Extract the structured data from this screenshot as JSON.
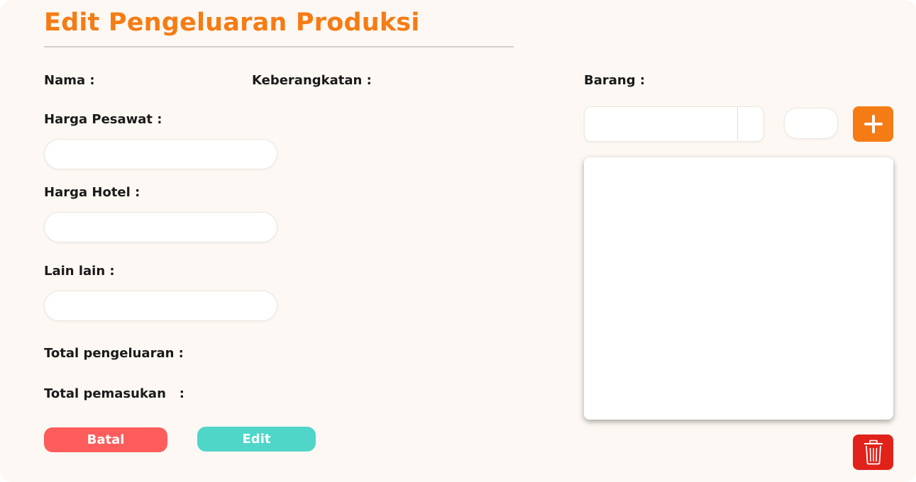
{
  "page": {
    "title": "Edit Pengeluaran Produksi"
  },
  "form": {
    "nama_label": "Nama :",
    "keberangkatan_label": "Keberangkatan :",
    "harga_pesawat_label": "Harga Pesawat :",
    "harga_pesawat_value": "",
    "harga_hotel_label": "Harga Hotel :",
    "harga_hotel_value": "",
    "lain_lain_label": "Lain lain :",
    "lain_lain_value": "",
    "total_pengeluaran_label": "Total pengeluaran :",
    "total_pemasukan_label": "Total pemasukan   :"
  },
  "actions": {
    "batal_label": "Batal",
    "edit_label": "Edit"
  },
  "barang": {
    "label": "Barang :",
    "add_icon": "plus-icon",
    "delete_icon": "trash-icon"
  },
  "colors": {
    "accent": "#f57c14",
    "cancel": "#ff5c5c",
    "edit": "#4fd6c9",
    "delete": "#e0221b",
    "background": "#fdf8f3"
  }
}
